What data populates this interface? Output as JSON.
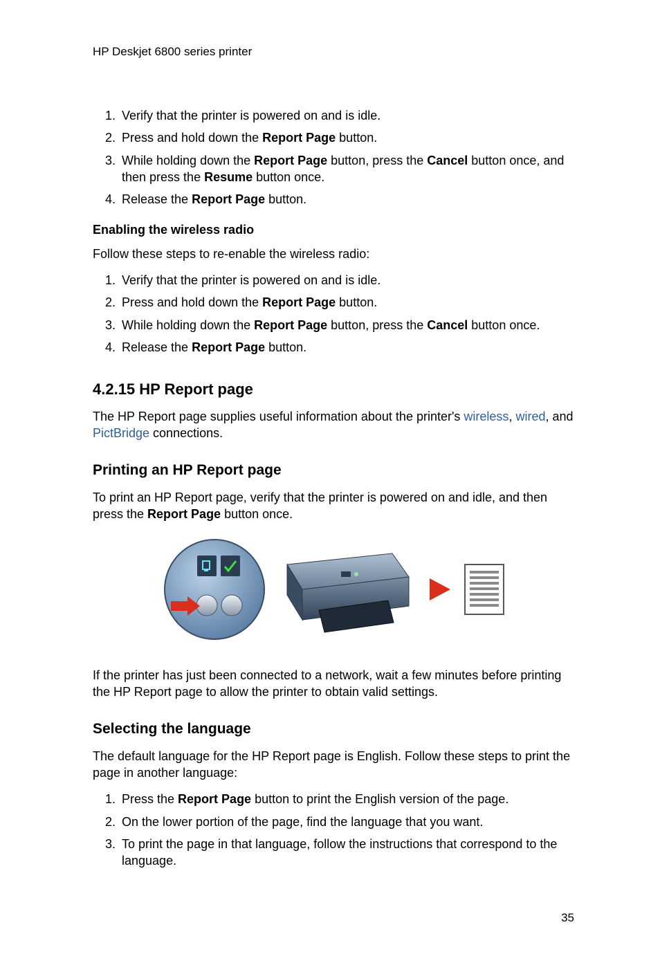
{
  "header": "HP Deskjet 6800 series printer",
  "list1": {
    "i1": "Verify that the printer is powered on and is idle.",
    "i2a": "Press and hold down the ",
    "i2b": "Report Page",
    "i2c": " button.",
    "i3a": "While holding down the ",
    "i3b": "Report Page",
    "i3c": " button, press the ",
    "i3d": "Cancel",
    "i3e": " button once, and then press the ",
    "i3f": "Resume",
    "i3g": " button once.",
    "i4a": "Release the ",
    "i4b": "Report Page",
    "i4c": " button."
  },
  "sub1": "Enabling the wireless radio",
  "p1": "Follow these steps to re-enable the wireless radio:",
  "list2": {
    "i1": "Verify that the printer is powered on and is idle.",
    "i2a": "Press and hold down the ",
    "i2b": "Report Page",
    "i2c": " button.",
    "i3a": "While holding down the ",
    "i3b": "Report Page",
    "i3c": " button, press the ",
    "i3d": "Cancel",
    "i3e": " button once.",
    "i4a": "Release the ",
    "i4b": "Report Page",
    "i4c": " button."
  },
  "h4215": "4.2.15  HP Report page",
  "p2a": "The HP Report page supplies useful information about the printer's ",
  "p2b": "wireless",
  "p2c": ", ",
  "p2d": "wired",
  "p2e": ", and ",
  "p2f": "PictBridge",
  "p2g": " connections.",
  "h_print": "Printing an HP Report page",
  "p3a": "To print an HP Report page, verify that the printer is powered on and idle, and then press the ",
  "p3b": "Report Page",
  "p3c": " button once.",
  "p4": "If the printer has just been connected to a network, wait a few minutes before printing the HP Report page to allow the printer to obtain valid settings.",
  "h_lang": "Selecting the language",
  "p5": "The default language for the HP Report page is English. Follow these steps to print the page in another language:",
  "list3": {
    "i1a": "Press the ",
    "i1b": "Report Page",
    "i1c": " button to print the English version of the page.",
    "i2": "On the lower portion of the page, find the language that you want.",
    "i3": "To print the page in that language, follow the instructions that correspond to the language."
  },
  "pagenum": "35"
}
